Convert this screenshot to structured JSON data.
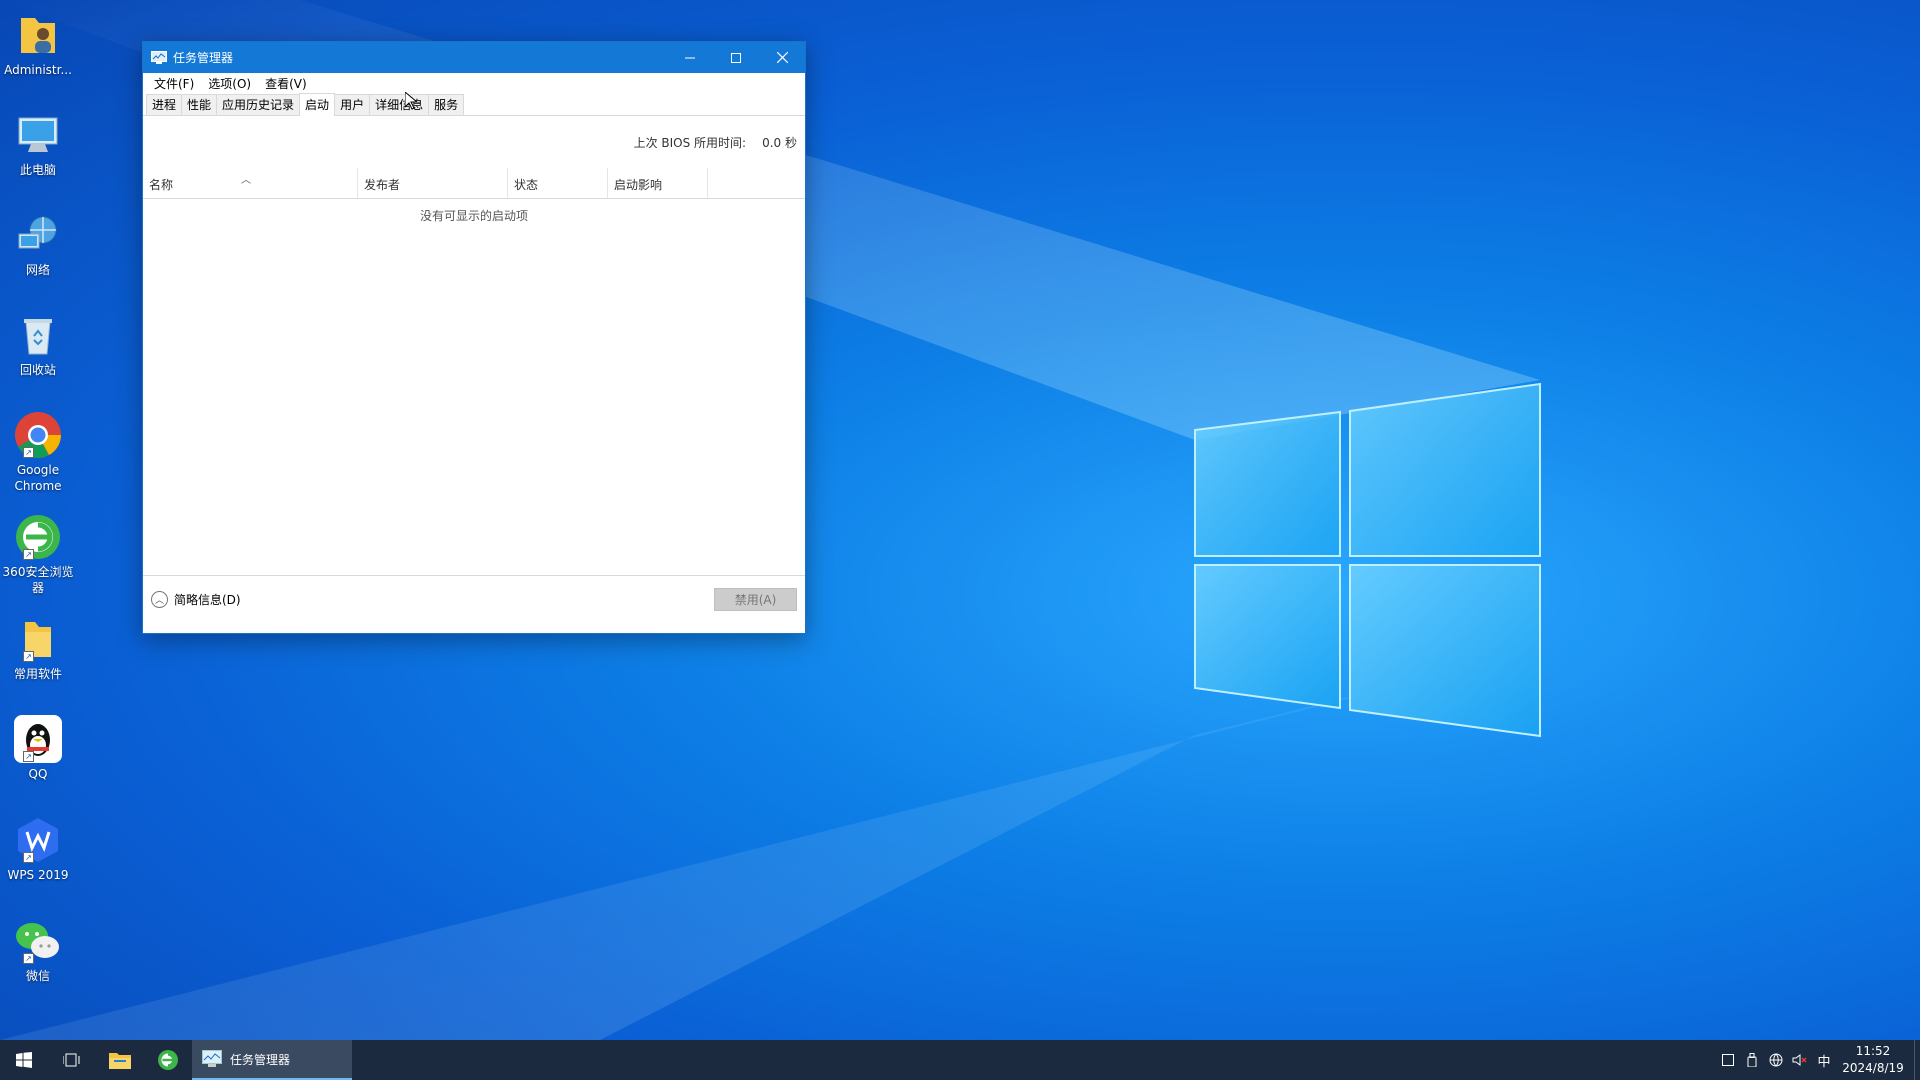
{
  "desktop": {
    "icons": [
      {
        "label": "Administr..."
      },
      {
        "label": "此电脑"
      },
      {
        "label": "网络"
      },
      {
        "label": "回收站"
      },
      {
        "label": "Google Chrome"
      },
      {
        "label": "360安全浏览器"
      },
      {
        "label": "常用软件"
      },
      {
        "label": "QQ"
      },
      {
        "label": "WPS 2019"
      },
      {
        "label": "微信"
      }
    ]
  },
  "window": {
    "title": "任务管理器",
    "menu": [
      "文件(F)",
      "选项(O)",
      "查看(V)"
    ],
    "tabs": [
      "进程",
      "性能",
      "应用历史记录",
      "启动",
      "用户",
      "详细信息",
      "服务"
    ],
    "active_tab": "启动",
    "bios_label": "上次 BIOS 所用时间:",
    "bios_value": "0.0 秒",
    "columns": [
      "名称",
      "发布者",
      "状态",
      "启动影响"
    ],
    "empty_message": "没有可显示的启动项",
    "fewer_details": "简略信息(D)",
    "disable_button": "禁用(A)"
  },
  "taskbar": {
    "running_app": "任务管理器",
    "ime": "中",
    "time": "11:52",
    "date": "2024/8/19"
  },
  "colors": {
    "titlebar": "#1479d6",
    "taskbar": "#1b2a3e"
  }
}
